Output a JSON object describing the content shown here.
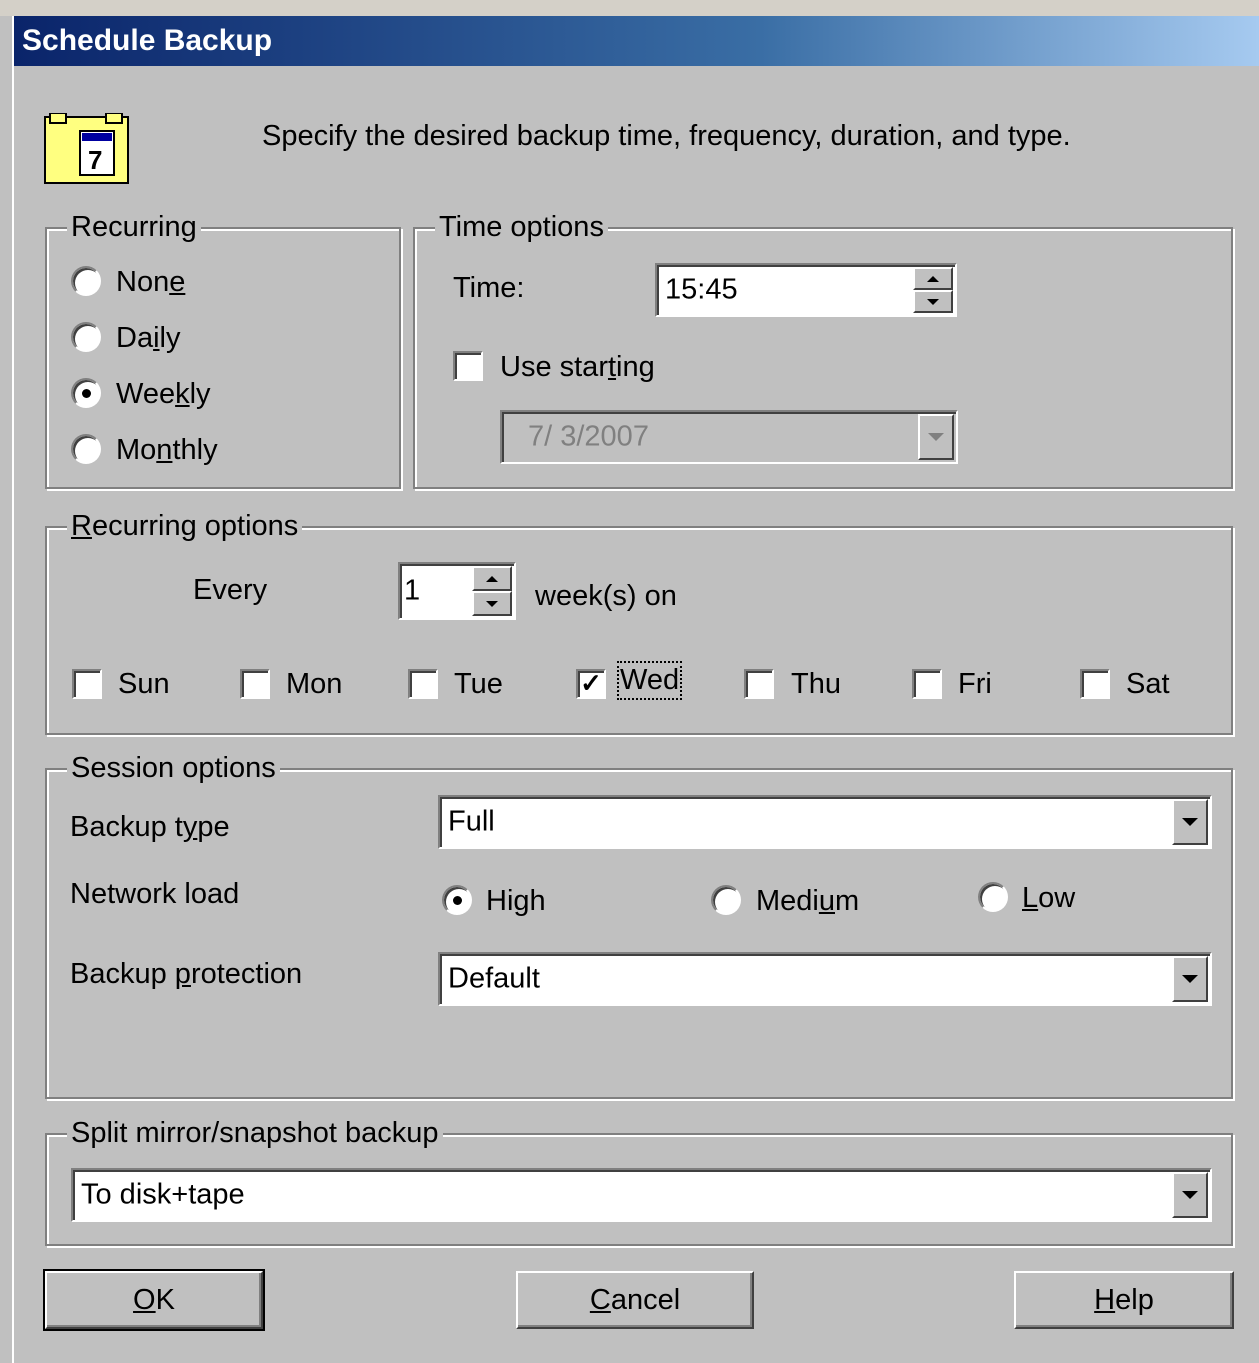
{
  "window": {
    "title": "Schedule Backup"
  },
  "header": {
    "description": "Specify the desired backup time, frequency, duration, and type.",
    "icon": "calendar-icon",
    "icon_day": "7"
  },
  "recurring": {
    "legend": "Recurring",
    "options": [
      "None",
      "Daily",
      "Weekly",
      "Monthly"
    ],
    "selected": "Weekly"
  },
  "time_options": {
    "legend": "Time options",
    "time_label": "Time:",
    "time_value": "15:45",
    "use_starting_label": "Use starting",
    "use_starting_checked": false,
    "start_date": "7/  3/2007"
  },
  "recurring_options": {
    "legend": "Recurring options",
    "every_label": "Every",
    "every_value": "1",
    "unit_label": "week(s) on",
    "days": [
      {
        "label": "Sun",
        "checked": false
      },
      {
        "label": "Mon",
        "checked": false
      },
      {
        "label": "Tue",
        "checked": false
      },
      {
        "label": "Wed",
        "checked": true
      },
      {
        "label": "Thu",
        "checked": false
      },
      {
        "label": "Fri",
        "checked": false
      },
      {
        "label": "Sat",
        "checked": false
      }
    ]
  },
  "session_options": {
    "legend": "Session options",
    "backup_type_label": "Backup type",
    "backup_type_value": "Full",
    "network_load_label": "Network load",
    "network_load_options": [
      "High",
      "Medium",
      "Low"
    ],
    "network_load_selected": "High",
    "backup_protection_label": "Backup protection",
    "backup_protection_value": "Default"
  },
  "split_mirror": {
    "legend": "Split mirror/snapshot backup",
    "value": "To disk+tape"
  },
  "buttons": {
    "ok": "OK",
    "cancel": "Cancel",
    "help": "Help"
  },
  "colors": {
    "dialog_bg": "#c0c0c0",
    "title_start": "#0a246a",
    "title_end": "#a6caf0"
  }
}
